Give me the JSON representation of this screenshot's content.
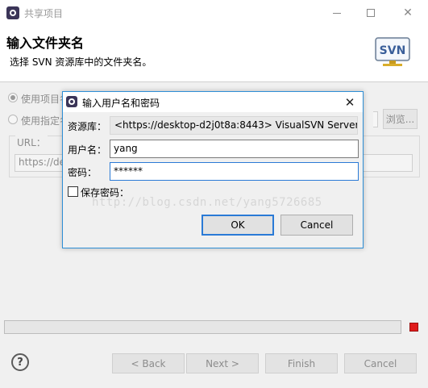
{
  "window": {
    "title": "共享项目",
    "header_title": "输入文件夹名",
    "header_desc": "选择 SVN 资源库中的文件夹名。",
    "logo_text": "SVN"
  },
  "options": {
    "use_project_name": "使用项目名",
    "use_specified": "使用指定名"
  },
  "url": {
    "label": "URL：",
    "value": "https://de"
  },
  "buttons": {
    "browse": "浏览...",
    "help": "?",
    "back": "< Back",
    "next": "Next >",
    "finish": "Finish",
    "cancel": "Cancel"
  },
  "dialog": {
    "title": "输入用户名和密码",
    "repo_label": "资源库：",
    "repo_value": "<https://desktop-d2j0t8a:8443> VisualSVN Server",
    "user_label": "用户名：",
    "user_value": "yang",
    "pwd_label": "密码：",
    "pwd_value": "******",
    "save_pwd_label": "保存密码：",
    "watermark": "http://blog.csdn.net/yang5726685",
    "ok": "OK",
    "cancel": "Cancel"
  },
  "colors": {
    "accent": "#2a7ad6",
    "stop": "#e01c1c",
    "disabled_text": "#8c8c8c"
  }
}
